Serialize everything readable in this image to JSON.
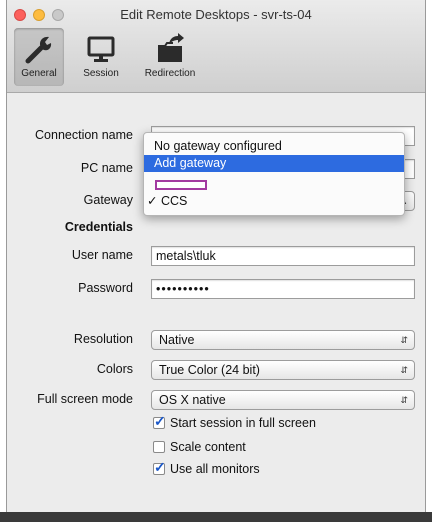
{
  "window": {
    "title": "Edit Remote Desktops - svr-ts-04"
  },
  "toolbar": {
    "general": "General",
    "session": "Session",
    "redirection": "Redirection"
  },
  "form": {
    "connection_name_label": "Connection name",
    "pc_name_label": "PC name",
    "gateway_label": "Gateway",
    "credentials_heading": "Credentials",
    "user_name_label": "User name",
    "user_name_value": "metals\\tluk",
    "password_label": "Password",
    "password_value": "••••••••••",
    "resolution_label": "Resolution",
    "resolution_value": "Native",
    "colors_label": "Colors",
    "colors_value": "True Color (24 bit)",
    "fullscreen_label": "Full screen mode",
    "fullscreen_value": "OS X native",
    "start_fullscreen": "Start session in full screen",
    "scale_content": "Scale content",
    "use_all_monitors": "Use all monitors"
  },
  "gateway_menu": {
    "items": [
      "No gateway configured",
      "Add gateway",
      "",
      "CCS"
    ],
    "highlighted": "Add gateway",
    "checked": "CCS",
    "check_mark": "✓"
  },
  "checkboxes": {
    "start_fullscreen_checked": true,
    "scale_content_checked": false,
    "use_all_monitors_checked": true
  },
  "colors": {
    "accent": "#2d6be0",
    "highlight_border": "#a23aa0"
  }
}
